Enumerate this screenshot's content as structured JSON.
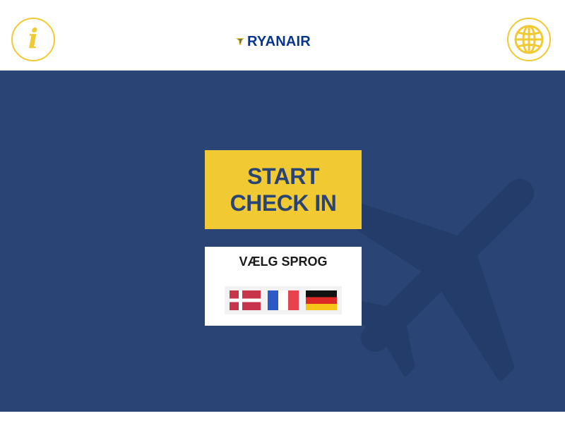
{
  "header": {
    "logo_text": "RYANAIR",
    "info_label": "i"
  },
  "main": {
    "start_button": {
      "line1": "START",
      "line2": "CHECK IN"
    },
    "language_panel": {
      "title": "VÆLG SPROG",
      "flags": [
        {
          "name": "danish-flag-icon"
        },
        {
          "name": "french-flag-icon"
        },
        {
          "name": "german-flag-icon"
        }
      ]
    }
  },
  "colors": {
    "brand_blue": "#073590",
    "background_blue": "#2a4476",
    "accent_yellow": "#f1c933"
  }
}
